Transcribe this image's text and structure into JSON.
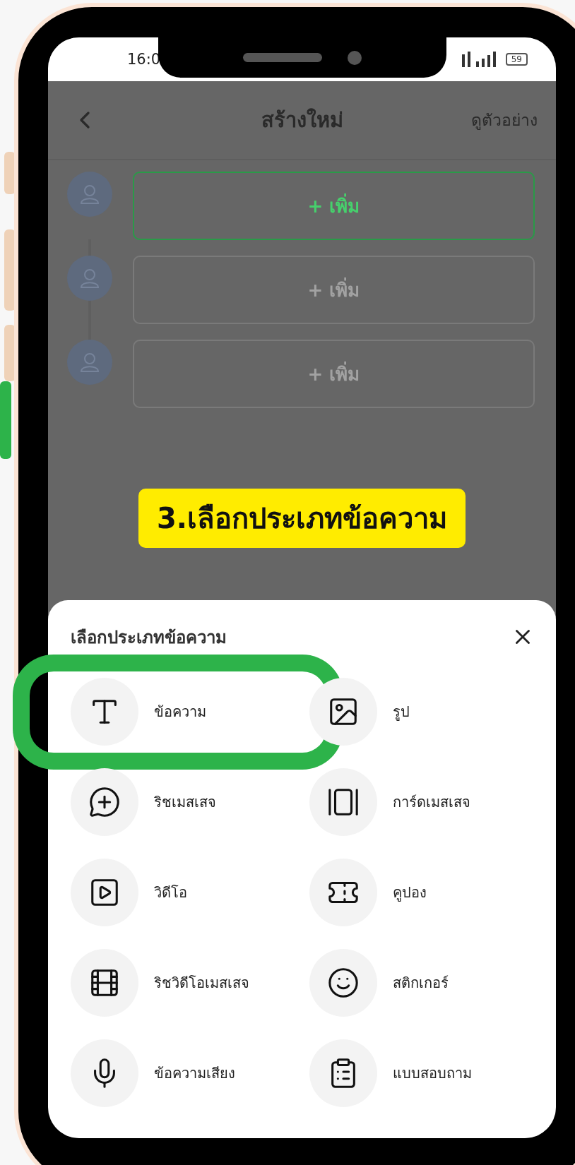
{
  "status_bar": {
    "time": "16:0",
    "battery": "59"
  },
  "header": {
    "title": "สร้างใหม่",
    "action": "ดูตัวอย่าง"
  },
  "messages": [
    {
      "label": "+ เพิ่ม",
      "selected": true
    },
    {
      "label": "+ เพิ่ม",
      "selected": false
    },
    {
      "label": "+ เพิ่ม",
      "selected": false
    }
  ],
  "callout": "3.เลือกประเภทข้อความ",
  "sheet": {
    "title": "เลือกประเภทข้อความ",
    "options": [
      {
        "kind": "text",
        "label": "ข้อความ",
        "highlighted": true
      },
      {
        "kind": "image",
        "label": "รูป",
        "highlighted": false
      },
      {
        "kind": "rich",
        "label": "ริชเมสเสจ",
        "highlighted": false
      },
      {
        "kind": "card",
        "label": "การ์ดเมสเสจ",
        "highlighted": false
      },
      {
        "kind": "video",
        "label": "วิดีโอ",
        "highlighted": false
      },
      {
        "kind": "coupon",
        "label": "คูปอง",
        "highlighted": false
      },
      {
        "kind": "richvideo",
        "label": "ริชวิดีโอเมสเสจ",
        "highlighted": false
      },
      {
        "kind": "sticker",
        "label": "สติกเกอร์",
        "highlighted": false
      },
      {
        "kind": "voice",
        "label": "ข้อความเสียง",
        "highlighted": false
      },
      {
        "kind": "survey",
        "label": "แบบสอบถาม",
        "highlighted": false
      }
    ]
  }
}
